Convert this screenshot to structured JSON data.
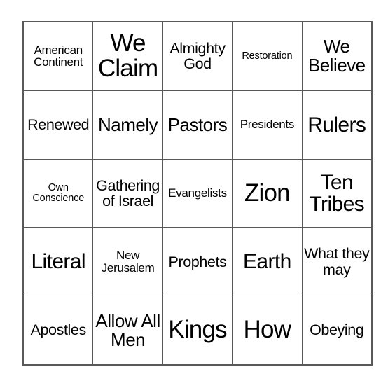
{
  "card": {
    "type": "bingo",
    "grid": {
      "rows": 5,
      "cols": 5
    },
    "colors": {
      "background": "#ffffff",
      "grid_line": "#595959",
      "text": "#000000"
    },
    "cells": [
      {
        "text": "American Continent",
        "size": "fs-sm",
        "row": 1,
        "col": 1
      },
      {
        "text": "We Claim",
        "size": "fs-xxl",
        "row": 1,
        "col": 2
      },
      {
        "text": "Almighty God",
        "size": "fs-md",
        "row": 1,
        "col": 3
      },
      {
        "text": "Restoration",
        "size": "fs-xs",
        "row": 1,
        "col": 4
      },
      {
        "text": "We Believe",
        "size": "fs-lg",
        "row": 1,
        "col": 5
      },
      {
        "text": "Renewed",
        "size": "fs-md",
        "row": 2,
        "col": 1
      },
      {
        "text": "Namely",
        "size": "fs-lg",
        "row": 2,
        "col": 2
      },
      {
        "text": "Pastors",
        "size": "fs-lg",
        "row": 2,
        "col": 3
      },
      {
        "text": "Presidents",
        "size": "fs-sm",
        "row": 2,
        "col": 4
      },
      {
        "text": "Rulers",
        "size": "fs-xl",
        "row": 2,
        "col": 5
      },
      {
        "text": "Own Conscience",
        "size": "fs-xs",
        "row": 3,
        "col": 1
      },
      {
        "text": "Gathering of Israel",
        "size": "fs-md",
        "row": 3,
        "col": 2
      },
      {
        "text": "Evangelists",
        "size": "fs-sm",
        "row": 3,
        "col": 3
      },
      {
        "text": "Zion",
        "size": "fs-xxl",
        "row": 3,
        "col": 4
      },
      {
        "text": "Ten Tribes",
        "size": "fs-xl",
        "row": 3,
        "col": 5
      },
      {
        "text": "Literal",
        "size": "fs-xl",
        "row": 4,
        "col": 1
      },
      {
        "text": "New Jerusalem",
        "size": "fs-sm",
        "row": 4,
        "col": 2
      },
      {
        "text": "Prophets",
        "size": "fs-md",
        "row": 4,
        "col": 3
      },
      {
        "text": "Earth",
        "size": "fs-xl",
        "row": 4,
        "col": 4
      },
      {
        "text": "What they may",
        "size": "fs-md",
        "row": 4,
        "col": 5
      },
      {
        "text": "Apostles",
        "size": "fs-md",
        "row": 5,
        "col": 1
      },
      {
        "text": "Allow All Men",
        "size": "fs-lg",
        "row": 5,
        "col": 2
      },
      {
        "text": "Kings",
        "size": "fs-xxl",
        "row": 5,
        "col": 3
      },
      {
        "text": "How",
        "size": "fs-xxl",
        "row": 5,
        "col": 4
      },
      {
        "text": "Obeying",
        "size": "fs-md",
        "row": 5,
        "col": 5
      }
    ]
  }
}
